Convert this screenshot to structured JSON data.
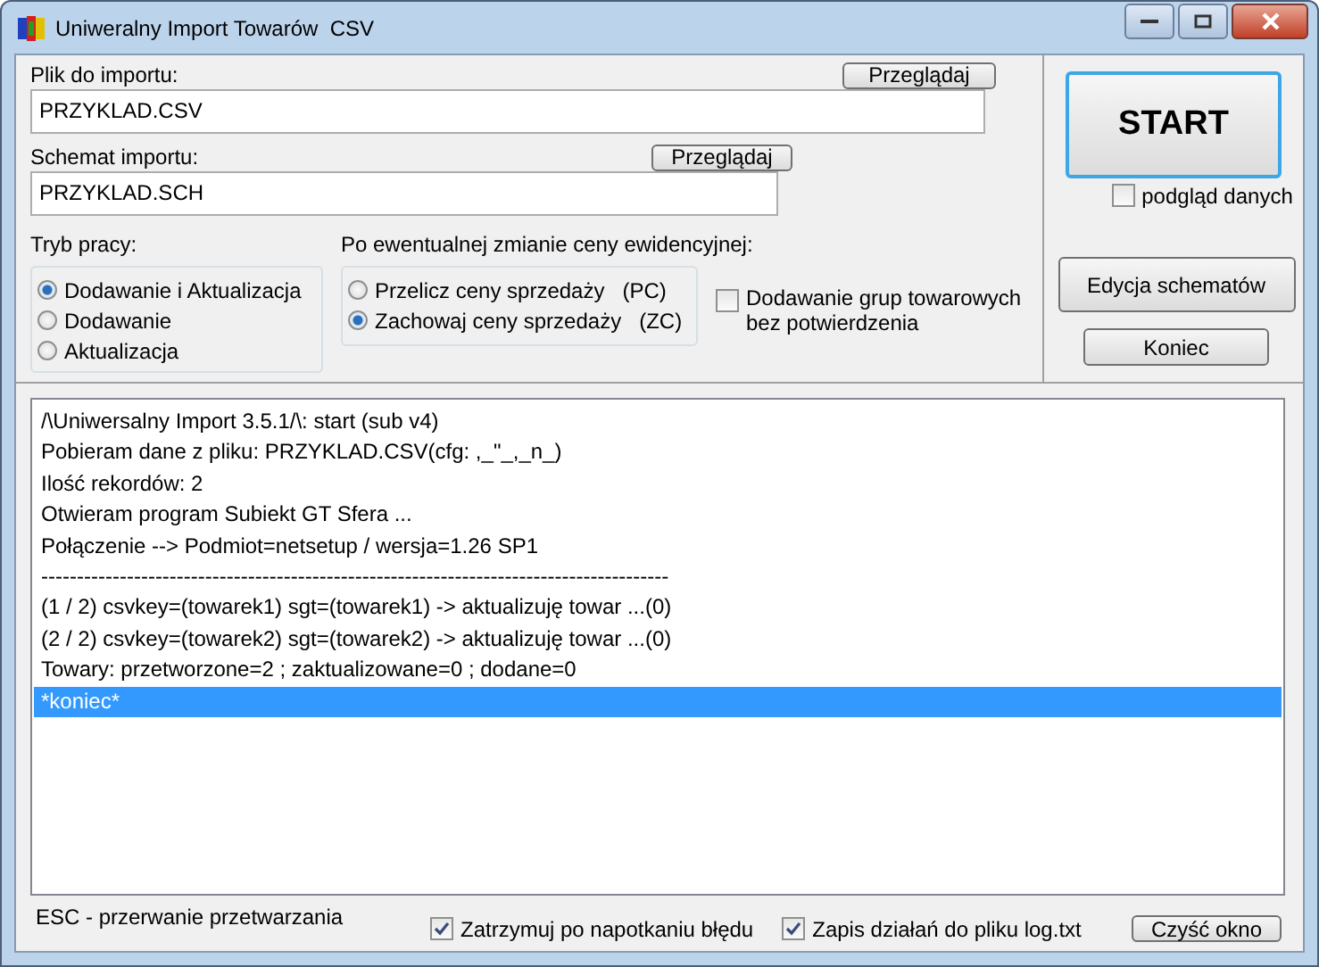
{
  "window": {
    "title": "Uniweralny Import Towarów  CSV"
  },
  "file": {
    "label": "Plik do importu:",
    "value": "PRZYKLAD.CSV",
    "browse": "Przeglądaj"
  },
  "schema": {
    "label": "Schemat importu:",
    "value": "PRZYKLAD.SCH",
    "browse": "Przeglądaj"
  },
  "mode": {
    "label": "Tryb pracy:",
    "options": [
      {
        "label": "Dodawanie i Aktualizacja",
        "selected": true
      },
      {
        "label": "Dodawanie",
        "selected": false
      },
      {
        "label": "Aktualizacja",
        "selected": false
      }
    ]
  },
  "price": {
    "label": "Po ewentualnej zmianie ceny ewidencyjnej:",
    "options": [
      {
        "label": "Przelicz ceny sprzedaży",
        "code": "(PC)",
        "selected": false
      },
      {
        "label": "Zachowaj ceny sprzedaży",
        "code": "(ZC)",
        "selected": true
      }
    ]
  },
  "group_option": {
    "label": "Dodawanie grup towarowych bez potwierdzenia",
    "checked": false
  },
  "start": "START",
  "preview": {
    "label": "podgląd danych",
    "checked": false
  },
  "buttons": [
    "Edycja schematów",
    "Koniec"
  ],
  "log": [
    {
      "text": "/\\Uniwersalny Import 3.5.1/\\: start (sub v4)",
      "selected": false
    },
    {
      "text": "Pobieram dane z pliku: PRZYKLAD.CSV(cfg: ,_\"_,_n_)",
      "selected": false
    },
    {
      "text": "Ilość rekordów: 2",
      "selected": false
    },
    {
      "text": "Otwieram program Subiekt GT Sfera ...",
      "selected": false
    },
    {
      "text": "Połączenie --> Podmiot=netsetup / wersja=1.26 SP1",
      "selected": false
    },
    {
      "text": "----------------------------------------------------------------------------------------",
      "selected": false
    },
    {
      "text": "(1 / 2) csvkey=(towarek1) sgt=(towarek1) -> aktualizuję towar ...(0)",
      "selected": false
    },
    {
      "text": "(2 / 2) csvkey=(towarek2) sgt=(towarek2) -> aktualizuję towar ...(0)",
      "selected": false
    },
    {
      "text": "Towary: przetworzone=2 ;  zaktualizowane=0 ;  dodane=0",
      "selected": false
    },
    {
      "text": "*koniec*",
      "selected": true
    }
  ],
  "status": "ESC - przerwanie przetwarzania",
  "options": [
    {
      "label": "Zatrzymuj po napotkaniu błędu",
      "checked": true
    },
    {
      "label": "Zapis działań do pliku log.txt",
      "checked": true
    }
  ],
  "clear": "Czyść okno"
}
